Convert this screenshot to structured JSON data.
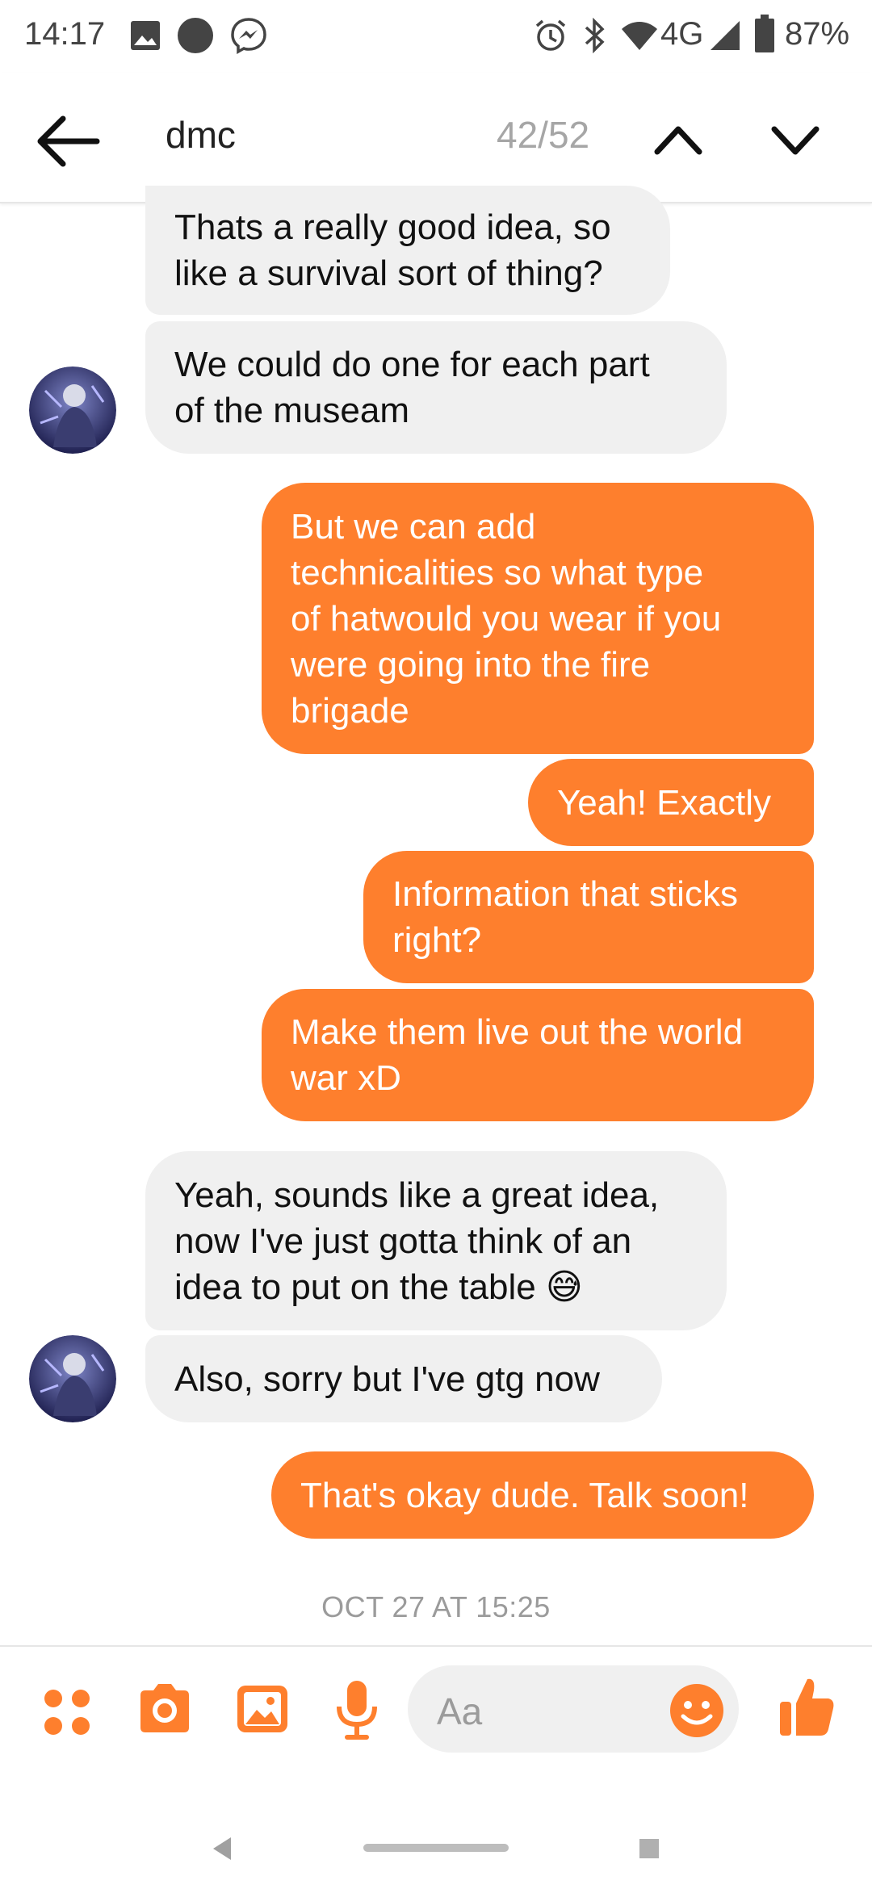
{
  "status_bar": {
    "time": "14:17",
    "network": "4G",
    "battery": "87%",
    "icons": [
      "image-icon",
      "circle-icon",
      "messenger-icon",
      "alarm-icon",
      "bluetooth-icon",
      "wifi-icon",
      "signal-icon",
      "battery-icon"
    ]
  },
  "header": {
    "search_query": "dmc",
    "match_count": "42/52"
  },
  "messages": [
    {
      "side": "received",
      "text_lines": [
        "Thats a really good idea, so",
        "like a survival sort of thing?"
      ]
    },
    {
      "side": "received",
      "text_lines": [
        "We could do one for each part",
        "of the museam"
      ]
    },
    {
      "side": "sent",
      "text_lines": [
        "But we can add",
        "technicalities so what type",
        "of hatwould you wear if you",
        "were going into the fire",
        "brigade"
      ]
    },
    {
      "side": "sent",
      "text_lines": [
        "Yeah! Exactly"
      ]
    },
    {
      "side": "sent",
      "text_lines": [
        "Information that sticks",
        "right?"
      ]
    },
    {
      "side": "sent",
      "text_lines": [
        "Make them live out the world",
        "war xD"
      ]
    },
    {
      "side": "received",
      "text_lines": [
        "Yeah, sounds like a great idea,",
        "now I've just gotta think of an",
        "idea to put on the table 😅"
      ]
    },
    {
      "side": "received",
      "text_lines": [
        "Also, sorry but I've gtg now"
      ]
    },
    {
      "side": "sent",
      "text_lines": [
        "That's okay dude. Talk soon!"
      ]
    }
  ],
  "timestamp": "OCT 27 AT 15:25",
  "composer": {
    "placeholder": "Aa",
    "icons": [
      "apps-icon",
      "camera-icon",
      "gallery-icon",
      "microphone-icon",
      "emoji-icon",
      "thumbs-up-icon"
    ]
  },
  "colors": {
    "accent": "#fe7f2d",
    "received_bubble": "#f0f0f0",
    "text_dark": "#111111",
    "muted": "#9b9b9b"
  }
}
